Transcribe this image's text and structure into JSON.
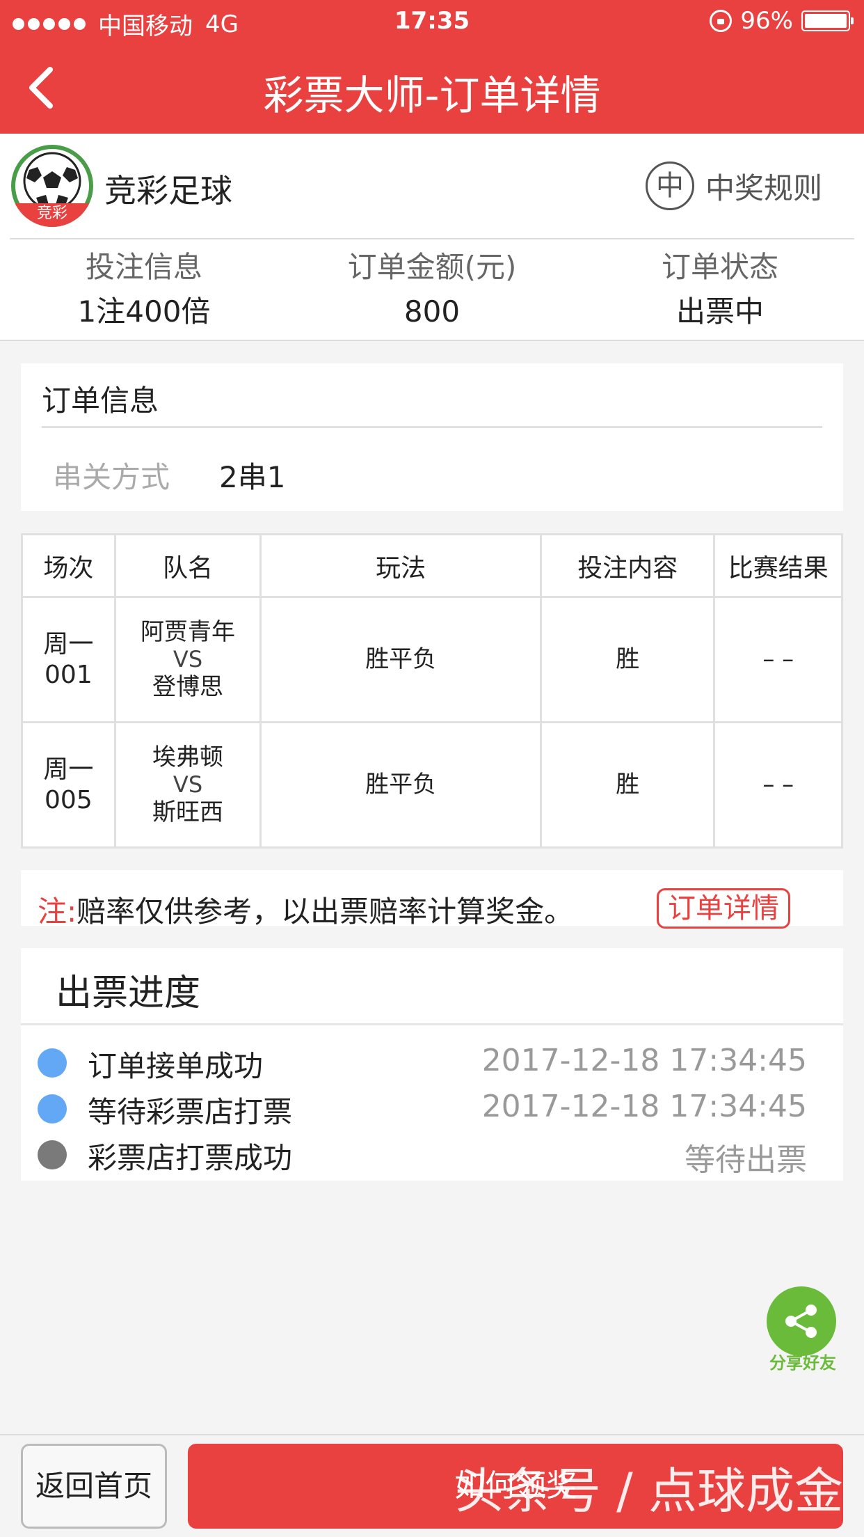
{
  "status_bar": {
    "carrier": "中国移动",
    "network": "4G",
    "time": "17:35",
    "battery": "96%"
  },
  "nav": {
    "title": "彩票大师-订单详情"
  },
  "header": {
    "lottery_name": "竞彩足球",
    "logo_badge": "竞彩",
    "rules_icon_char": "中",
    "rules_label": "中奖规则"
  },
  "summary": [
    {
      "label": "投注信息",
      "value": "1注400倍"
    },
    {
      "label": "订单金额(元)",
      "value": "800"
    },
    {
      "label": "订单状态",
      "value": "出票中"
    }
  ],
  "order_info": {
    "title": "订单信息",
    "parlay_label": "串关方式",
    "parlay_value": "2串1"
  },
  "table": {
    "headers": [
      "场次",
      "队名",
      "玩法",
      "投注内容",
      "比赛结果"
    ],
    "rows": [
      {
        "seq_day": "周一",
        "seq_no": "001",
        "home": "阿贾青年",
        "vs": "VS",
        "away": "登博思",
        "play": "胜平负",
        "bet": "胜",
        "result": "– –"
      },
      {
        "seq_day": "周一",
        "seq_no": "005",
        "home": "埃弗顿",
        "vs": "VS",
        "away": "斯旺西",
        "play": "胜平负",
        "bet": "胜",
        "result": "– –"
      }
    ]
  },
  "note": {
    "prefix": "注:",
    "text": "赔率仅供参考，以出票赔率计算奖金。",
    "button": "订单详情"
  },
  "progress": {
    "title": "出票进度",
    "steps": [
      {
        "label": "订单接单成功",
        "time": "2017-12-18 17:34:45",
        "color": "#62a8f5"
      },
      {
        "label": "等待彩票店打票",
        "time": "2017-12-18 17:34:45",
        "color": "#62a8f5"
      },
      {
        "label": "彩票店打票成功",
        "time": "等待出票",
        "color": "#7a7a7a"
      }
    ]
  },
  "share": {
    "label": "分享好友"
  },
  "bottom": {
    "home_label": "返回首页",
    "action_label": "如何领奖",
    "watermark": "头条号 / 点球成金"
  },
  "colors": {
    "brand_red": "#e94140",
    "share_green": "#6bbb3a"
  }
}
